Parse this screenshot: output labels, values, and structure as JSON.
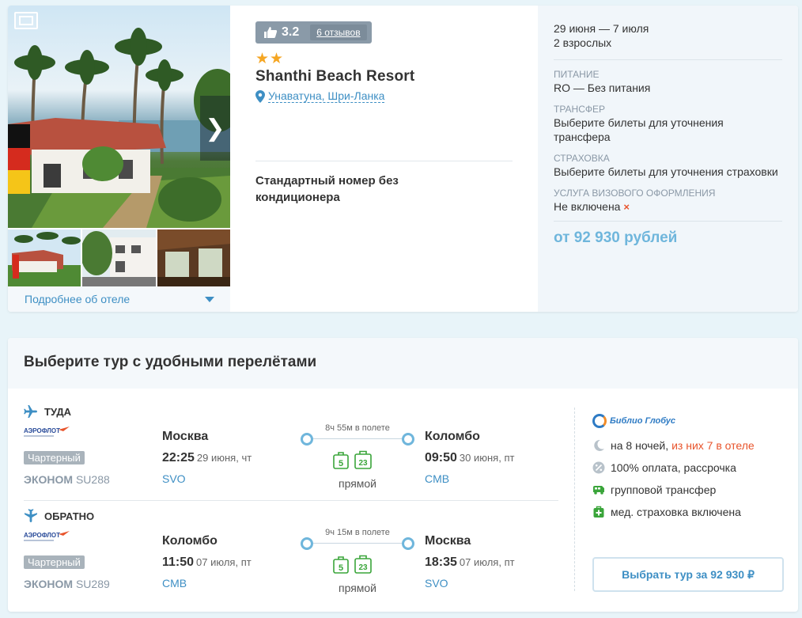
{
  "hotel": {
    "rating": "3.2",
    "reviews": "6 отзывов",
    "stars": "★★",
    "name": "Shanthi Beach Resort",
    "location": "Унаватуна, Шри-Ланка",
    "room": "Стандартный номер без кондиционера",
    "more_link": "Подробнее об отеле"
  },
  "details": {
    "dates": "29 июня — 7 июля",
    "guests": "2 взрослых",
    "meal_label": "ПИТАНИЕ",
    "meal_value": "RO — Без питания",
    "transfer_label": "ТРАНСФЕР",
    "transfer_value": "Выберите билеты для уточнения трансфера",
    "insurance_label": "СТРАХОВКА",
    "insurance_value": "Выберите билеты для уточнения страховки",
    "visa_label": "УСЛУГА ВИЗОВОГО ОФОРМЛЕНИЯ",
    "visa_value": "Не включена",
    "visa_mark": "×",
    "price": "от 92 930 рублей"
  },
  "tours": {
    "heading": "Выберите тур с удобными перелётами",
    "outbound": {
      "direction": "ТУДА",
      "charter": "Чартерный",
      "class": "ЭКОНОМ",
      "flight_no": "SU288",
      "dep_city": "Москва",
      "dep_time": "22:25",
      "dep_date": "29 июня, чт",
      "dep_code": "SVO",
      "duration": "8ч 55м в полете",
      "bag1": "5",
      "bag2": "23",
      "type": "прямой",
      "arr_city": "Коломбо",
      "arr_time": "09:50",
      "arr_date": "30 июня, пт",
      "arr_code": "CMB"
    },
    "return": {
      "direction": "ОБРАТНО",
      "charter": "Чартерный",
      "class": "ЭКОНОМ",
      "flight_no": "SU289",
      "dep_city": "Коломбо",
      "dep_time": "11:50",
      "dep_date": "07 июля, пт",
      "dep_code": "CMB",
      "duration": "9ч 15м в полете",
      "bag1": "5",
      "bag2": "23",
      "type": "прямой",
      "arr_city": "Москва",
      "arr_time": "18:35",
      "arr_date": "07 июля, пт",
      "arr_code": "SVO"
    },
    "operator": {
      "name": "Библио Глобус",
      "nights": "на 8 ночей,",
      "nights_hotel": "из них 7 в отеле",
      "payment": "100% оплата, рассрочка",
      "transfer": "групповой трансфер",
      "insurance": "мед. страховка включена"
    },
    "button": "Выбрать тур за 92 930 ₽"
  },
  "colors": {
    "accent_blue": "#3e8fc4",
    "price_blue": "#6fb6dc",
    "highlight_red": "#e8542c",
    "baggage_green": "#3aa53a",
    "star_orange": "#f5a623"
  }
}
